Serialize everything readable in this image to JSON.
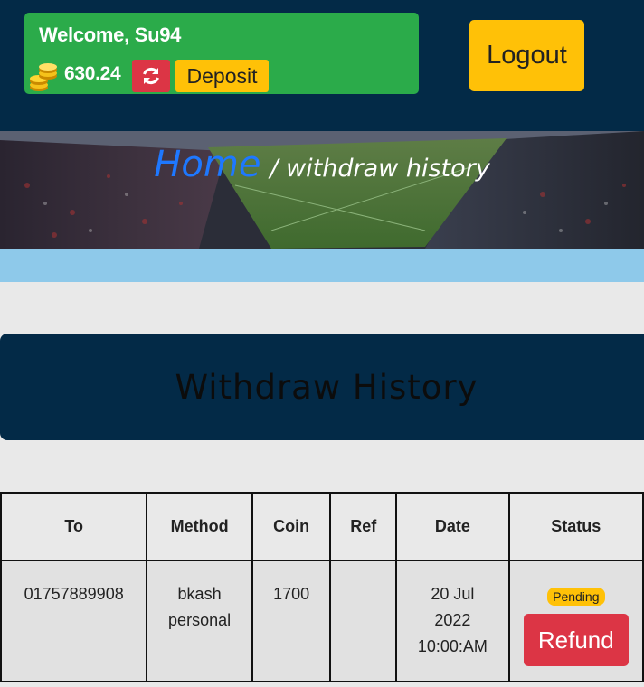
{
  "header": {
    "welcome": "Welcome, Su94",
    "balance": "630.24",
    "deposit_label": "Deposit",
    "logout_label": "Logout"
  },
  "breadcrumb": {
    "home": "Home",
    "current": "/ withdraw history"
  },
  "page_title": "Withdraw History",
  "table": {
    "headers": [
      "To",
      "Method",
      "Coin",
      "Ref",
      "Date",
      "Status"
    ],
    "rows": [
      {
        "to": "01757889908",
        "method_line1": "bkash",
        "method_line2": "personal",
        "coin": "1700",
        "ref": "",
        "date_line1": "20 Jul",
        "date_line2": "2022",
        "date_line3": "10:00:AM",
        "status": "Pending",
        "action": "Refund"
      }
    ]
  },
  "icons": {
    "coins": "coins-icon",
    "refresh": "refresh-icon"
  },
  "colors": {
    "navy": "#032a47",
    "green": "#2bab4a",
    "yellow": "#ffc107",
    "red": "#dc3545",
    "light_blue": "#8ec9ea"
  }
}
